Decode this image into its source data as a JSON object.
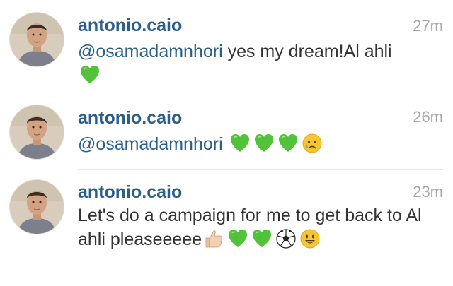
{
  "comments": [
    {
      "username": "antonio.caio",
      "timestamp": "27m",
      "mention": "@osamadamnhori",
      "text": " yes my dream!Al ahli",
      "emojis": [
        "green-heart-icon"
      ]
    },
    {
      "username": "antonio.caio",
      "timestamp": "26m",
      "mention": "@osamadamnhori",
      "text": "",
      "emojis": [
        "green-heart-icon",
        "green-heart-icon",
        "green-heart-icon",
        "sad-face-icon"
      ]
    },
    {
      "username": "antonio.caio",
      "timestamp": "23m",
      "mention": "",
      "text": "Let's do a campaign for me to get back to Al ahli pleaseeeee",
      "emojis": [
        "thumbs-up-icon",
        "green-heart-icon",
        "green-heart-icon",
        "soccer-ball-icon",
        "smiley-icon"
      ]
    }
  ],
  "colors": {
    "username": "#2b5f8a",
    "timestamp": "#a6a6a6",
    "text": "#333333",
    "divider": "#e8e8e8"
  }
}
